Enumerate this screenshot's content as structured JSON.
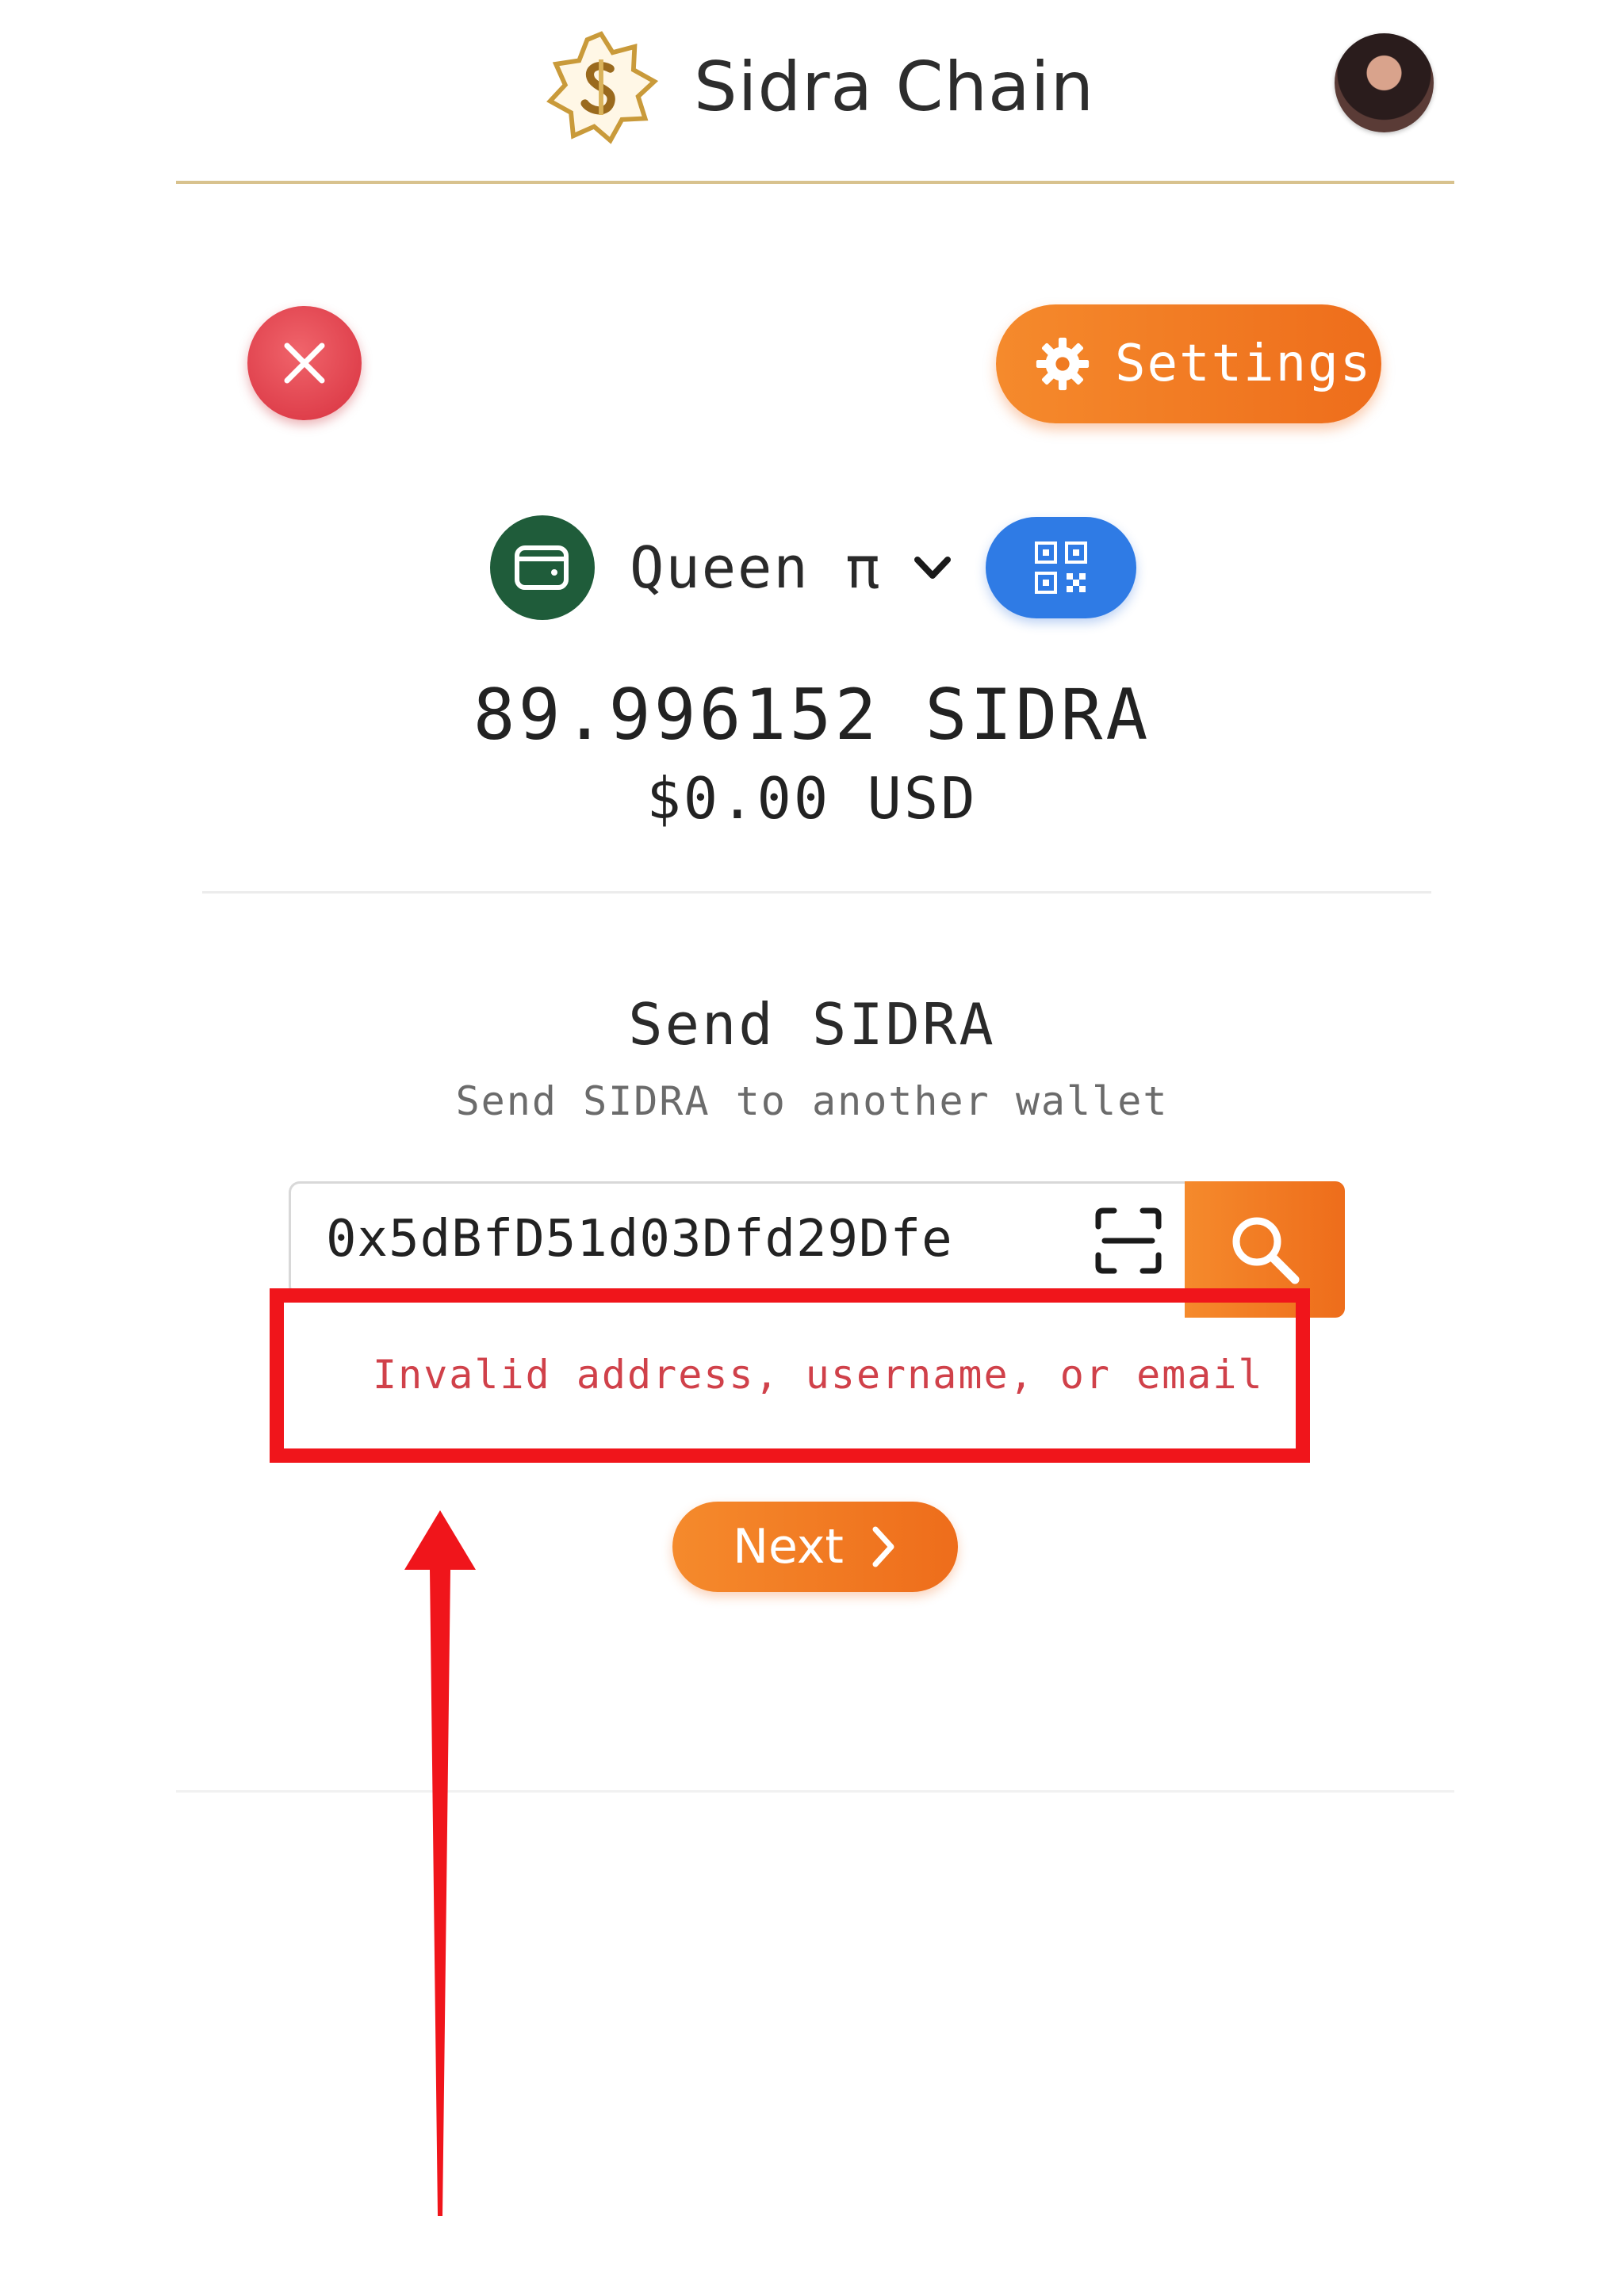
{
  "header": {
    "app_name": "Sidra Chain",
    "logo_icon": "sidra-logo-icon",
    "avatar_icon": "user-avatar"
  },
  "actions": {
    "close_icon": "close-icon",
    "settings_label": "Settings",
    "settings_icon": "gear-icon"
  },
  "wallet": {
    "icon": "wallet-icon",
    "name": "Queen π",
    "dropdown_icon": "chevron-down-icon",
    "qr_icon": "qr-code-icon"
  },
  "balance": {
    "amount": "89.996152 SIDRA",
    "usd": "$0.00 USD"
  },
  "send": {
    "title": "Send SIDRA",
    "subtitle": "Send SIDRA to another wallet",
    "address_value": "0x5dBfD51d03Dfd29Dfe",
    "scan_icon": "scan-icon",
    "search_icon": "search-icon",
    "error": "Invalid address, username, or email",
    "next_label": "Next",
    "next_icon": "chevron-right-icon"
  },
  "colors": {
    "accent_orange": "#F0771F",
    "close_red": "#E0404A",
    "qr_blue": "#2F7BE5",
    "wallet_green": "#1F5C3A",
    "error_red": "#D0414A",
    "annotation_red": "#F0151B",
    "gold_rule": "#D8C28E"
  }
}
